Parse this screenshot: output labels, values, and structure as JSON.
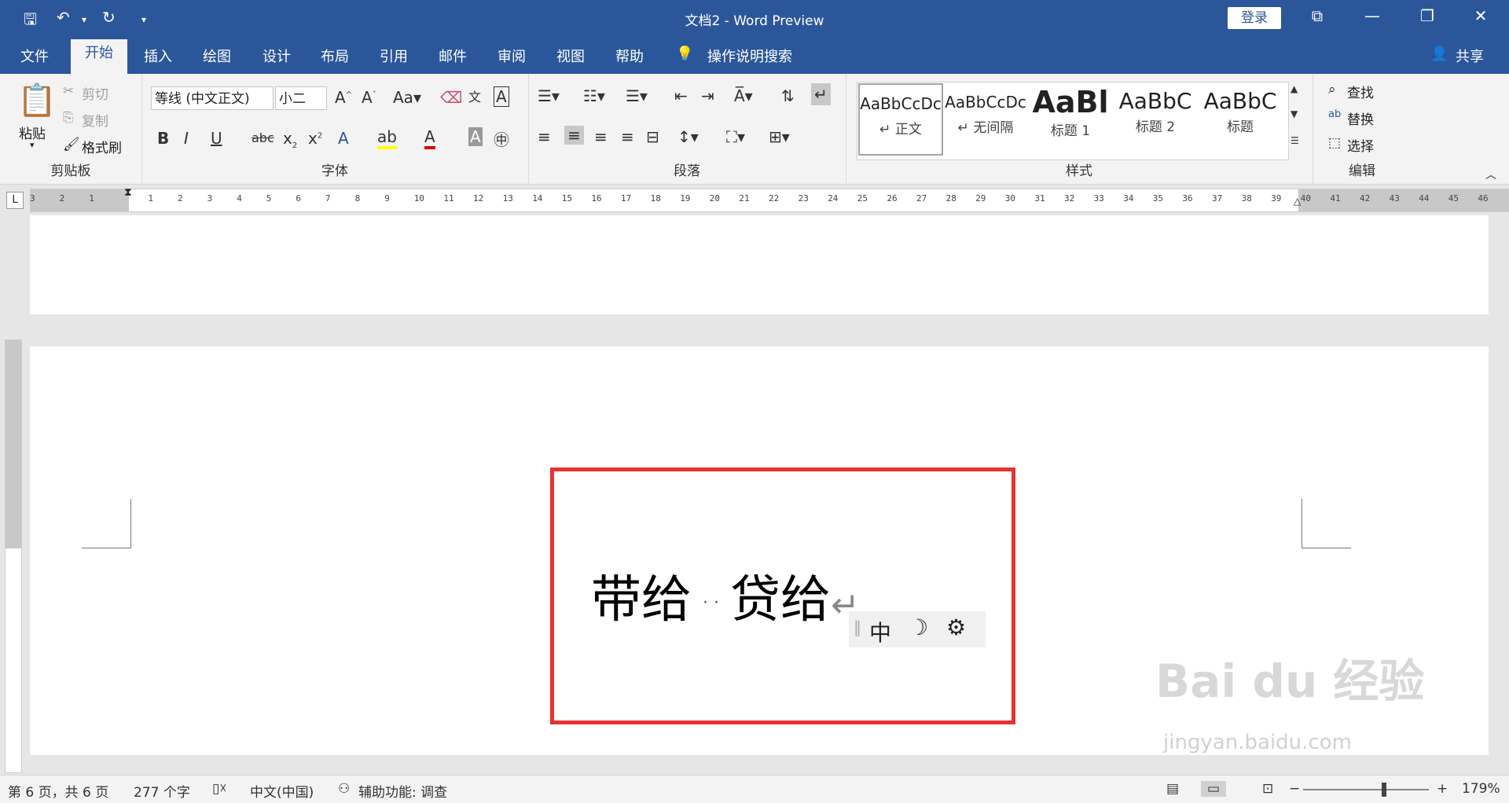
{
  "titlebar": {
    "title": "文档2  -  Word Preview",
    "login": "登录",
    "save_icon": "save-icon",
    "undo_icon": "undo-icon",
    "redo_icon": "redo-icon"
  },
  "tabs": [
    "文件",
    "开始",
    "插入",
    "绘图",
    "设计",
    "布局",
    "引用",
    "邮件",
    "审阅",
    "视图",
    "帮助"
  ],
  "tell_me": "操作说明搜索",
  "share": "共享",
  "clipboard": {
    "paste": "粘贴",
    "cut": "剪切",
    "copy": "复制",
    "format_painter": "格式刷",
    "label": "剪贴板"
  },
  "font": {
    "name": "等线 (中文正文)",
    "size": "小二",
    "label": "字体"
  },
  "paragraph": {
    "label": "段落"
  },
  "styles": {
    "items": [
      {
        "sample": "AaBbCcDc",
        "name": "↵ 正文"
      },
      {
        "sample": "AaBbCcDc",
        "name": "↵ 无间隔"
      },
      {
        "sample": "AaBl",
        "name": "标题 1"
      },
      {
        "sample": "AaBbC",
        "name": "标题 2"
      },
      {
        "sample": "AaBbC",
        "name": "标题"
      }
    ],
    "label": "样式"
  },
  "editing": {
    "find": "查找",
    "replace": "替换",
    "select": "选择",
    "label": "编辑"
  },
  "ruler_numbers": [
    "3",
    "2",
    "1",
    "",
    "1",
    "2",
    "3",
    "4",
    "5",
    "6",
    "7",
    "8",
    "9",
    "10",
    "11",
    "12",
    "13",
    "14",
    "15",
    "16",
    "17",
    "18",
    "19",
    "20",
    "21",
    "22",
    "23",
    "24",
    "25",
    "26",
    "27",
    "28",
    "29",
    "30",
    "31",
    "32",
    "33",
    "34",
    "35",
    "36",
    "37",
    "38",
    "39",
    "40",
    "41",
    "42",
    "43",
    "44",
    "45",
    "46"
  ],
  "document": {
    "text_part1": "带给",
    "dots": "· ·",
    "text_part2": "贷给",
    "para_mark": "↵"
  },
  "ime": {
    "mode": "中",
    "moon": "☽",
    "gear": "⚙"
  },
  "status": {
    "page": "第 6 页，共 6 页",
    "words": "277 个字",
    "language": "中文(中国)",
    "accessibility": "辅助功能: 调查",
    "zoom": "179%"
  },
  "watermark": {
    "brand": "Bai du 经验",
    "url": "jingyan.baidu.com"
  },
  "colors": {
    "accent": "#2b579a",
    "highlight_border": "#e53333"
  }
}
